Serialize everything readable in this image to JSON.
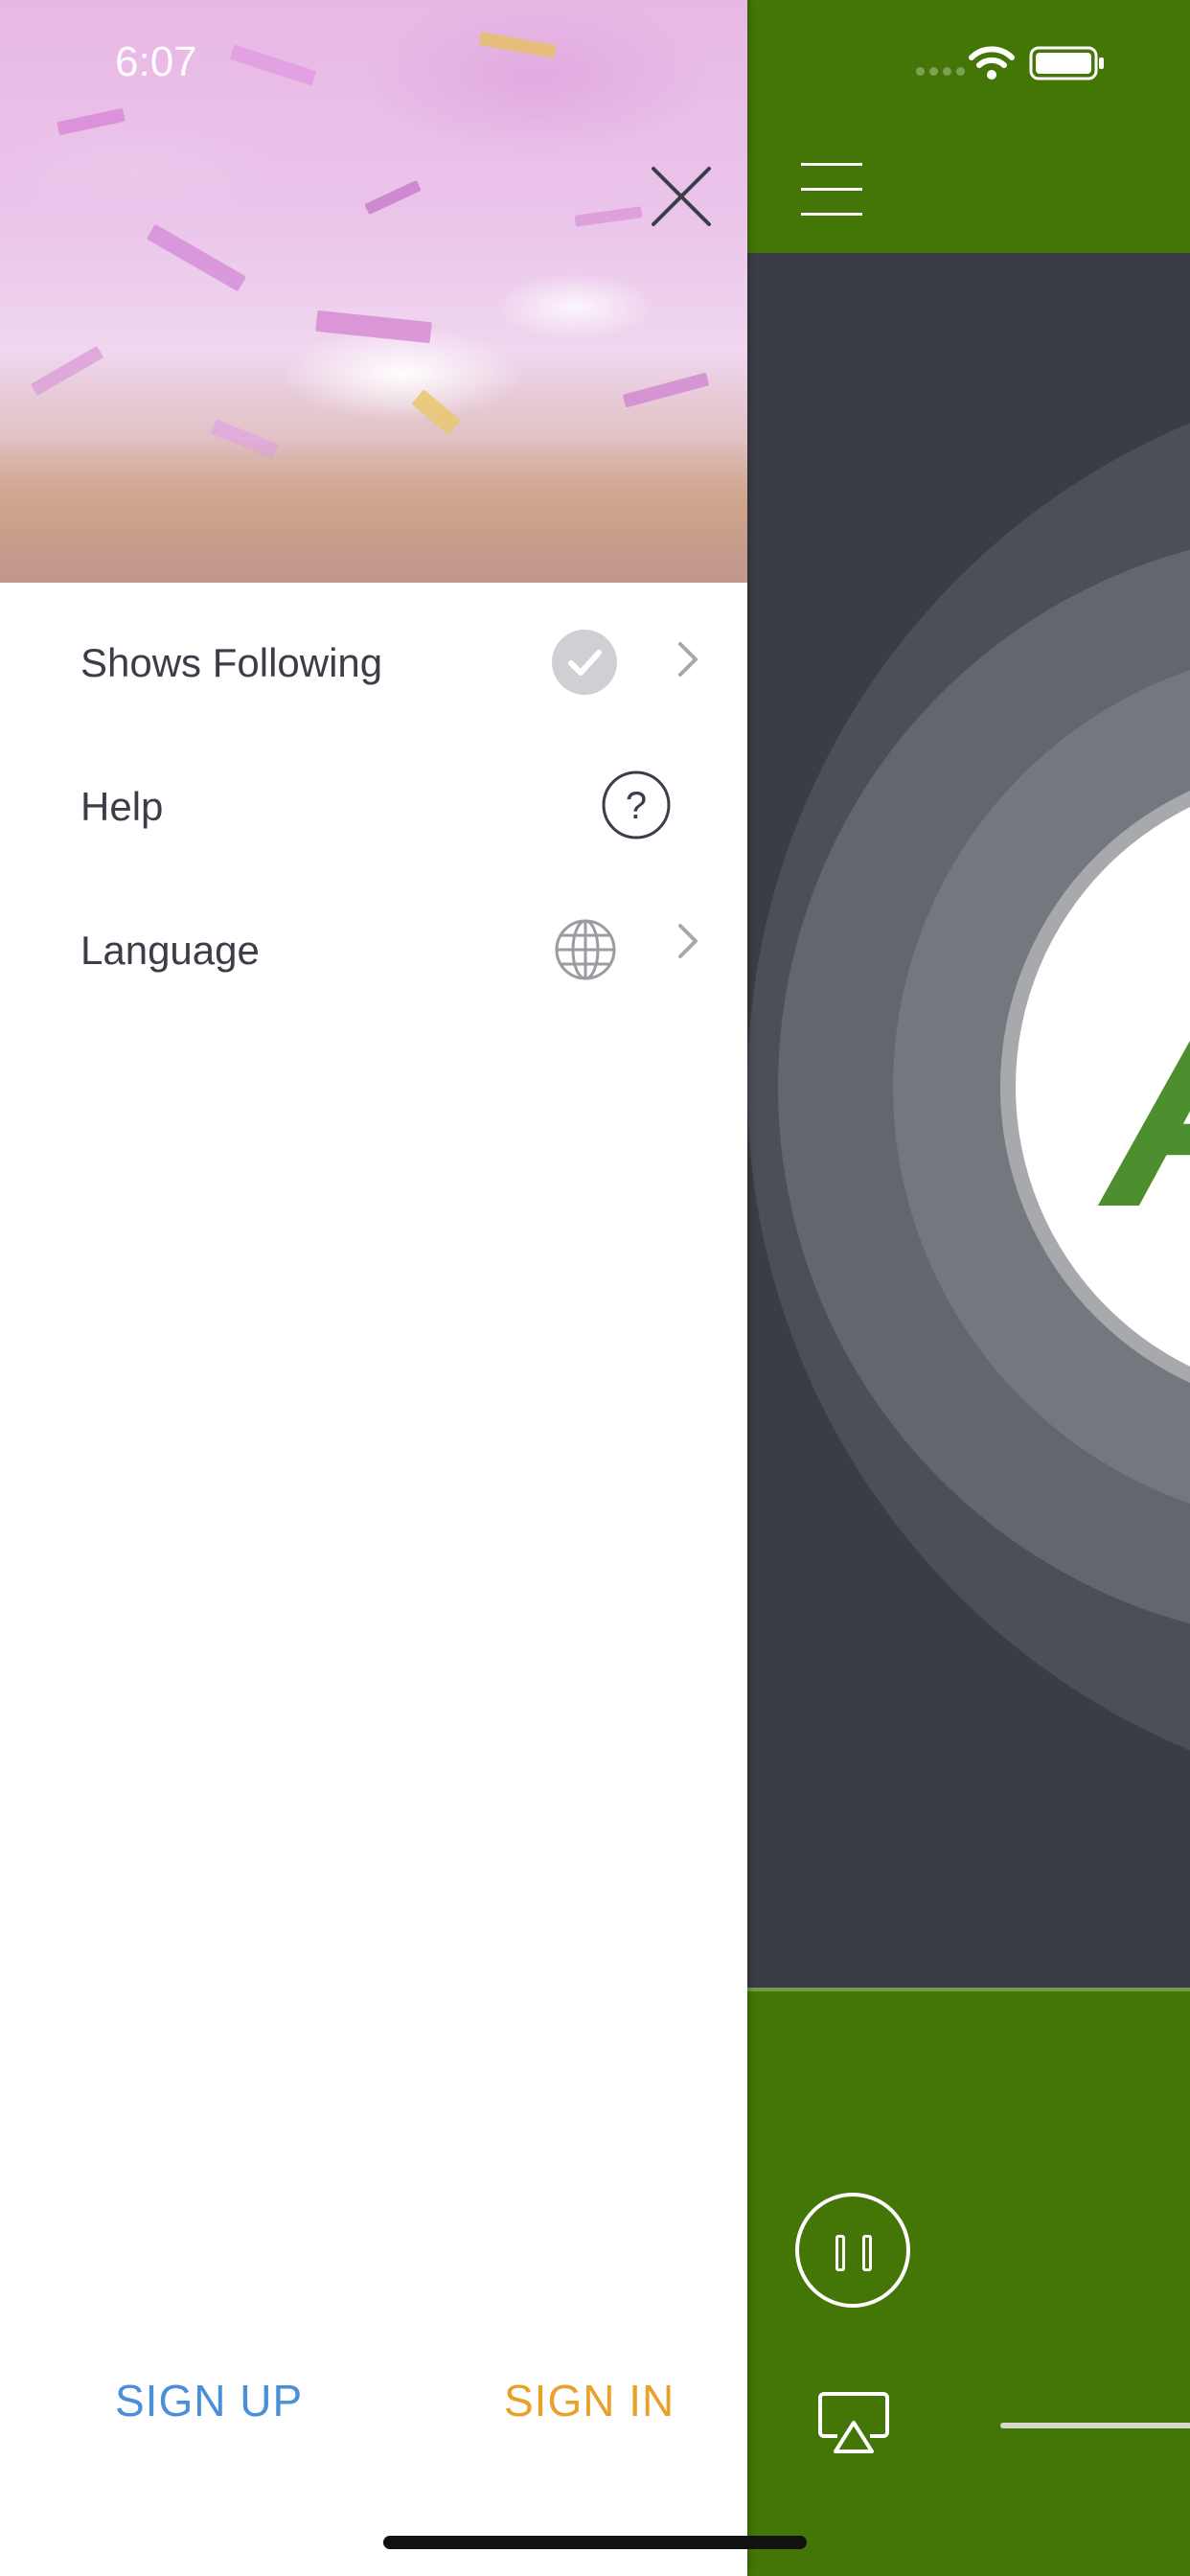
{
  "status_bar": {
    "time": "6:07"
  },
  "menu": {
    "items": [
      {
        "label": "Shows Following",
        "icon": "checkmark-circle-icon",
        "has_chevron": true
      },
      {
        "label": "Help",
        "icon": "question-circle-icon",
        "has_chevron": false
      },
      {
        "label": "Language",
        "icon": "globe-icon",
        "has_chevron": true
      }
    ]
  },
  "auth": {
    "sign_up": "SIGN UP",
    "sign_in": "SIGN IN"
  },
  "main": {
    "logo_letter": "A"
  },
  "colors": {
    "brand_green": "#437607",
    "sign_up": "#4a90d9",
    "sign_in": "#e8a22a",
    "menu_text": "#3b3d48"
  }
}
